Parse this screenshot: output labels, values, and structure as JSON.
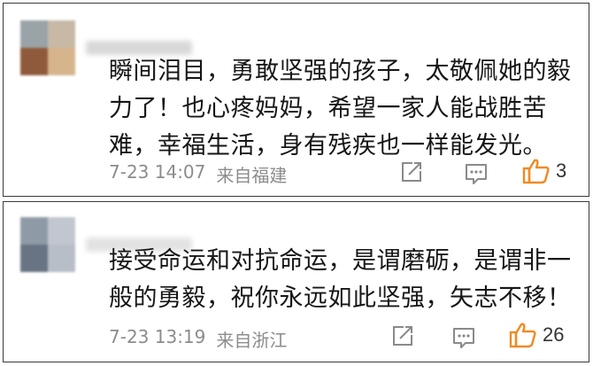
{
  "comments": [
    {
      "avatar_colors": [
        "#9aa4a8",
        "#c7b9a6",
        "#8f5a3b",
        "#d6b48c"
      ],
      "name_blur_color": "#d8d8d8",
      "text": "瞬间泪目，勇敢坚强的孩子，太敬佩她的毅\n力了！也心疼妈妈，希望一家人能战胜苦\n难，幸福生活，身有残疾也一样能发光。",
      "date": "7-23 14:07",
      "source": "来自福建",
      "like_count": "3",
      "icons": {
        "share": "share-icon",
        "comment": "comment-icon",
        "like": "thumbs-up-icon"
      }
    },
    {
      "avatar_colors": [
        "#8f9aa7",
        "#c2c7cf",
        "#687483",
        "#b7bec7"
      ],
      "name_blur_color": "#e2e2e2",
      "text": "接受命运和对抗命运，是谓磨砺，是谓非一\n般的勇毅，祝你永远如此坚强，矢志不移！",
      "date": "7-23 13:19",
      "source": "来自浙江",
      "like_count": "26",
      "icons": {
        "share": "share-icon",
        "comment": "comment-icon",
        "like": "thumbs-up-icon"
      }
    }
  ],
  "colors": {
    "like_accent": "#f08a24",
    "meta_text": "#8c8c8c",
    "icon_gray": "#8a8a8a"
  }
}
